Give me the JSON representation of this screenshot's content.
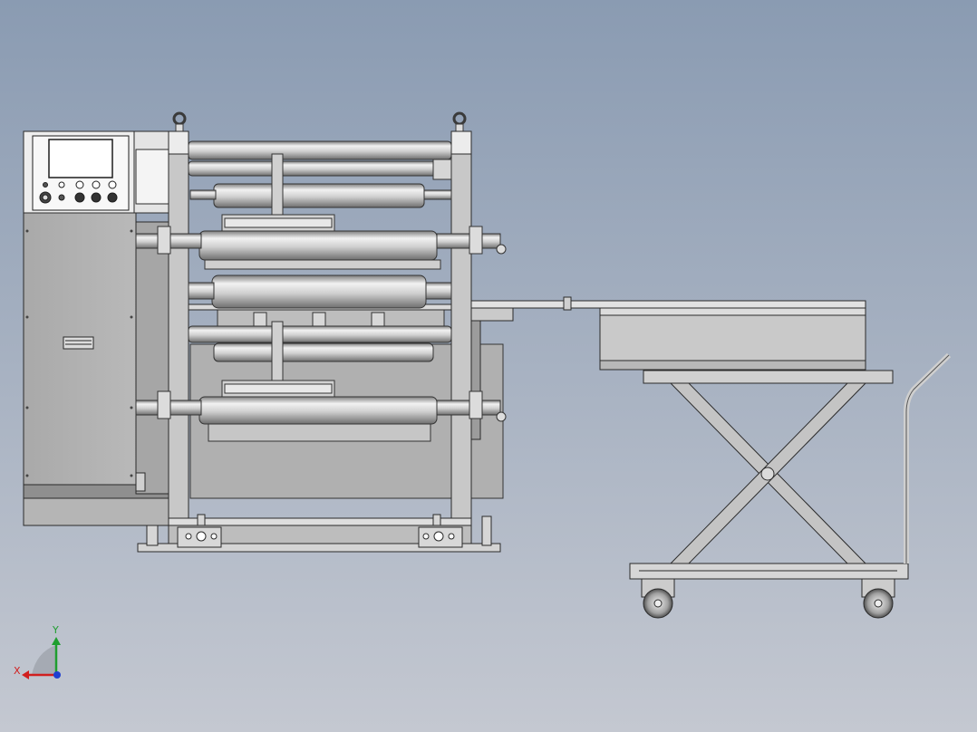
{
  "view": {
    "background_top": "#8a9bb2",
    "background_bottom": "#c4c8d1"
  },
  "triad": {
    "x_label": "X",
    "y_label": "Y",
    "x_color": "#d11f1f",
    "y_color": "#1f9e2f",
    "z_color": "#1f3fd1"
  },
  "model": {
    "parts": [
      "control-cabinet",
      "touch-screen",
      "control-buttons",
      "machine-frame",
      "upper-guide-roller",
      "slitting-rollers",
      "rewind-shafts",
      "lifting-eyes",
      "base-frame",
      "adjustable-feet",
      "transfer-table",
      "scissor-lift-cart",
      "cart-handle",
      "cart-wheels"
    ]
  }
}
